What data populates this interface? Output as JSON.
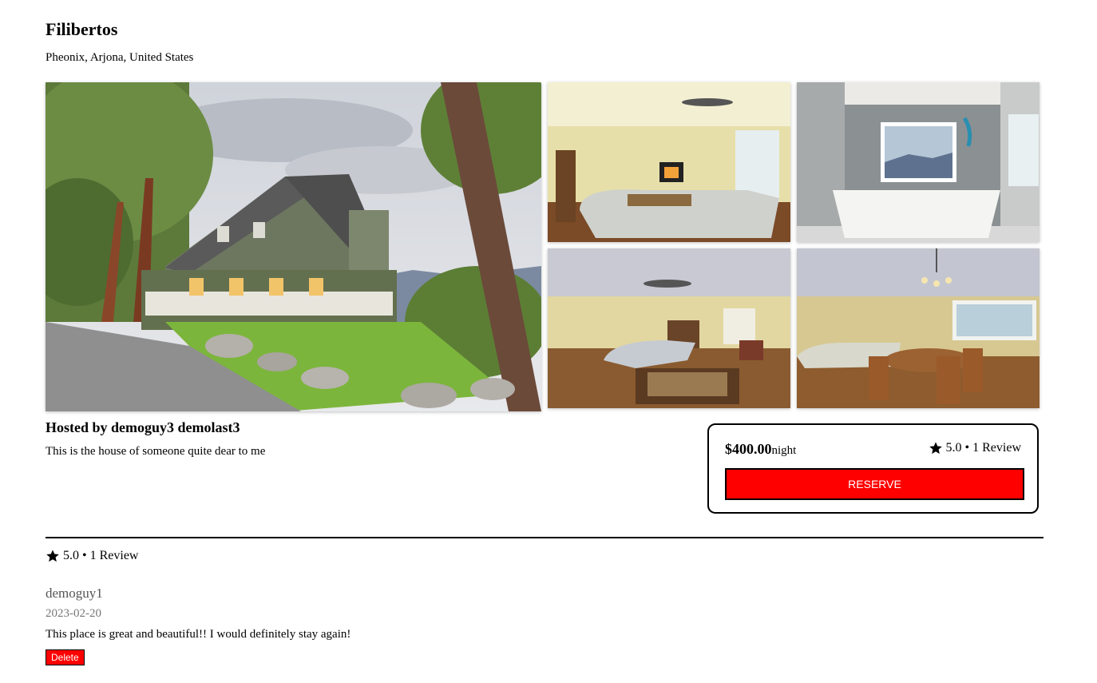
{
  "listing": {
    "title": "Filibertos",
    "location": "Pheonix, Arjona, United States",
    "host": "Hosted by demoguy3 demolast3",
    "description": "This is the house of someone quite dear to me"
  },
  "photos": [
    {
      "name": "main-photo-house-exterior"
    },
    {
      "name": "photo-living-room"
    },
    {
      "name": "photo-bathroom-tub"
    },
    {
      "name": "photo-open-living-area"
    },
    {
      "name": "photo-dining-room"
    }
  ],
  "booking": {
    "price": "$400.00",
    "unit": "night",
    "rating": "5.0 • 1 Review",
    "reserve_label": "RESERVE",
    "reserve_color": "#ff0000"
  },
  "reviews_summary": "5.0 • 1 Review",
  "reviews": [
    {
      "author": "demoguy1",
      "date": "2023-02-20",
      "text": "This place is great and beautiful!! I would definitely stay again!",
      "delete_label": "Delete"
    }
  ],
  "icons": {
    "star": "star-icon"
  }
}
